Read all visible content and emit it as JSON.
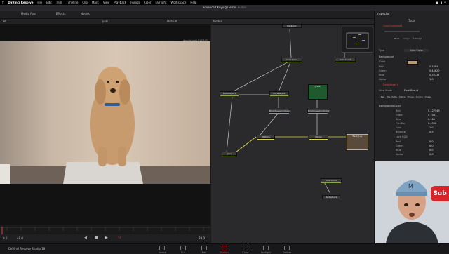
{
  "macbar": {
    "app": "DaVinci Resolve",
    "menus": [
      "File",
      "Edit",
      "Trim",
      "Timeline",
      "Clip",
      "Mark",
      "View",
      "Playback",
      "Fusion",
      "Color",
      "Fairlight",
      "Workspace",
      "Help"
    ]
  },
  "titlebar": {
    "project": "Advanced Keying Demo",
    "edited": "Edited"
  },
  "toolbar": {
    "mediapool": "Media Pool",
    "effects": "Effects",
    "nodes": "Nodes",
    "inspector": "Inspector",
    "metadata": "Metadata"
  },
  "viewer": {
    "title": "poki",
    "zoom": "Fit",
    "default": "Default",
    "clip_label": "doodle poki/ELCB45",
    "timecode": "28.0",
    "frame_start": "0.0",
    "frame_end": "48.0"
  },
  "nodes": {
    "panel_title": "Nodes",
    "items": {
      "mediain": "MediaIn1",
      "colorcorr": "ColorCorr1",
      "delta": "DeltaKeyer1",
      "ultra": "UltraKeyer1",
      "green": "green",
      "bright1": "BrightnessContrast1",
      "bright2": "BrightnessContrast2",
      "multiply": "Multiply",
      "merge": "Merge",
      "mediaout": "MediaOut1",
      "colorcorr2": "ColorCorr2",
      "colorcorr3": "ColorCorr3",
      "pipe": "pipe",
      "back": "Back_Lay"
    }
  },
  "inspector": {
    "title": "Inspector",
    "tool": "Tools",
    "node1": "ColorCorrector1",
    "section1": "Background",
    "tabs1": [
      "Tools",
      "Image",
      "Settings"
    ],
    "mode_label": "Type",
    "mode_value": "Solid Color",
    "rows1": [
      {
        "label": "Color",
        "value": ""
      },
      {
        "label": "Red",
        "value": "0.7064"
      },
      {
        "label": "Green",
        "value": "0.45620"
      },
      {
        "label": "Blue",
        "value": "0.35731"
      },
      {
        "label": "Alpha",
        "value": "1.0"
      }
    ],
    "node2": "DeltaKeyer1",
    "tabs2": [
      "Key",
      "Pre-Matte",
      "Matte",
      "Fringe",
      "Tuning",
      "Image"
    ],
    "view_label": "View Mode",
    "view_value": "Final Result",
    "section2": "Background Color",
    "rows2": [
      {
        "label": "Red",
        "value": "0.127545"
      },
      {
        "label": "Green",
        "value": "0.7081"
      },
      {
        "label": "Blue",
        "value": "0.165"
      },
      {
        "label": "Pre-Blur",
        "value": "0.4392"
      },
      {
        "label": "Gain",
        "value": "1.0"
      },
      {
        "label": "Balance",
        "value": "0.5"
      },
      {
        "label": "Lock RGB",
        "value": ""
      },
      {
        "label": "Red",
        "value": "0.0"
      },
      {
        "label": "Green",
        "value": "0.0"
      },
      {
        "label": "Blue",
        "value": "0.0"
      },
      {
        "label": "Alpha",
        "value": "0.0"
      }
    ]
  },
  "pagebar": {
    "app_footer": "DaVinci Resolve Studio 18",
    "pages": [
      "Media",
      "Cut",
      "Edit",
      "Fusion",
      "Color",
      "Fairlight",
      "Deliver"
    ]
  },
  "webcam": {
    "badge": "Sub"
  }
}
